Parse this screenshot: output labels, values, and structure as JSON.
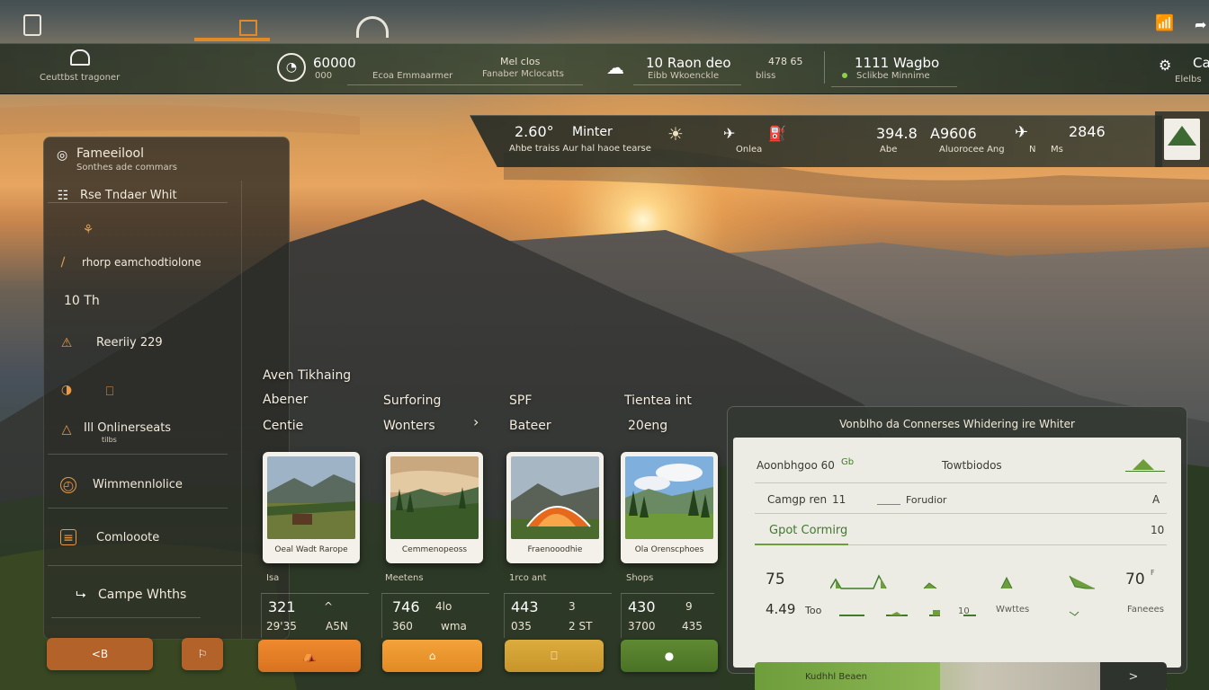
{
  "top_strip": {
    "icons": [
      "door-icon",
      "factory-icon",
      "hut-icon",
      "wifi-icon",
      "share-icon"
    ]
  },
  "header": {
    "logo_label": "Ceuttbst tragoner",
    "stat1_value": "60000",
    "stat1_sub": "000",
    "stat1_caption": "Ecoa Emmaarmer",
    "stat2_title": "Mel clos",
    "stat2_caption": "Fanaber Mclocatts",
    "weather_title": "10 Raon deo",
    "weather_caption": "Eibb Wkoenckle",
    "stat3_value": "478 65",
    "stat3_sub": "bliss",
    "stat4_title": "1111 Wagbo",
    "stat4_caption": "Sclikbe Minnime",
    "right_label": "Elelbs",
    "right_value": "Ca"
  },
  "weather_bar": {
    "temp": "2.60°",
    "name": "Minter",
    "caption": "Ahbe traiss Aur hal haoe tearse",
    "icon1_label": "Onlea",
    "metric1": "394.8",
    "metric1_unit": "Abe",
    "metric2": "A9606",
    "metric2_caption": "Aluorocee Ang",
    "metric3_sub": "N",
    "metric4": "2846",
    "metric4_sub": "Ms"
  },
  "sidebar": {
    "title": "Fameeilool",
    "subtitle": "Sonthes ade commars",
    "items": [
      {
        "icon": "binoculars-icon",
        "label": "Rse Tndaer Whit"
      },
      {
        "icon": "flashlight-icon",
        "label": ""
      },
      {
        "icon": "trail-icon",
        "label": "rhorp eamchodtiolone"
      },
      {
        "icon": "",
        "label": "10 Th"
      },
      {
        "icon": "warning-icon",
        "label": "Reeriiy 229"
      },
      {
        "icon": "compass-icon",
        "label": ""
      },
      {
        "icon": "campfire-icon",
        "label": "Ill Onlinerseats"
      },
      {
        "icon": "clock-icon",
        "label": "Wimmennlolice"
      },
      {
        "icon": "book-icon",
        "label": "Comlooote"
      },
      {
        "icon": "route-icon",
        "label": "Campe Whths"
      }
    ],
    "item_sub": "tilbs",
    "btn1": "<B",
    "btn2_icon": "map-icon"
  },
  "categories": [
    {
      "line1": "Aven Tikhaing",
      "line2": "Abener",
      "line3": "Centie"
    },
    {
      "line1": "",
      "line2": "Surforing",
      "line3": "Wonters"
    },
    {
      "line1": "",
      "line2": "SPF",
      "line3": "Bateer"
    },
    {
      "line1": "",
      "line2": "Tientea int",
      "line3": "20eng"
    }
  ],
  "cards": [
    {
      "caption": "Oeal Wadt Rarope",
      "label": "Isa",
      "v1": "321",
      "v1b": "^",
      "v2": "29'35",
      "v2b": "A5N",
      "btn_icon": "tent-icon"
    },
    {
      "caption": "Cemmenopeoss",
      "label": "Meetens",
      "v1": "746",
      "v1b": "4lo",
      "v2": "360",
      "v2b": "wma",
      "btn_icon": "backpack-icon"
    },
    {
      "caption": "Fraenooodhie",
      "label": "1rco ant",
      "v1": "443",
      "v1b": "3",
      "v2": "035",
      "v2b": "2 ST",
      "btn_icon": "lantern-icon"
    },
    {
      "caption": "Ola Orenscphoes",
      "label": "Shops",
      "v1": "430",
      "v1b": "9",
      "v2": "3700",
      "v2b": "435",
      "btn_icon": "bird-icon"
    }
  ],
  "panel": {
    "header": "Vonblho da Connerses Whidering ire Whiter",
    "row1_left": "Aoonbhgoo 60",
    "row1_tag": "Gb",
    "row1_mid": "Towtbiodos",
    "row2_left": "Camgp ren",
    "row2_val": "11",
    "row2_mid": "Forudior",
    "row2_right": "A",
    "row3_left": "Gpot Cormirg",
    "row3_right": "10",
    "b1_val": "75",
    "b1_right": "70",
    "b1_right_unit": "F",
    "b2_val": "4.49",
    "b2_sub": "Too",
    "b2_mid": "10",
    "b2_caption": "Wwttes",
    "b2_right": "Faneees",
    "progress_label": "Kudhhl Beaen",
    "progress_value": 0.45,
    "progress_btn": ">"
  },
  "colors": {
    "accent_orange": "#e88a2c",
    "accent_green": "#6e9d3c",
    "panel_bg": "#ecebe4"
  }
}
